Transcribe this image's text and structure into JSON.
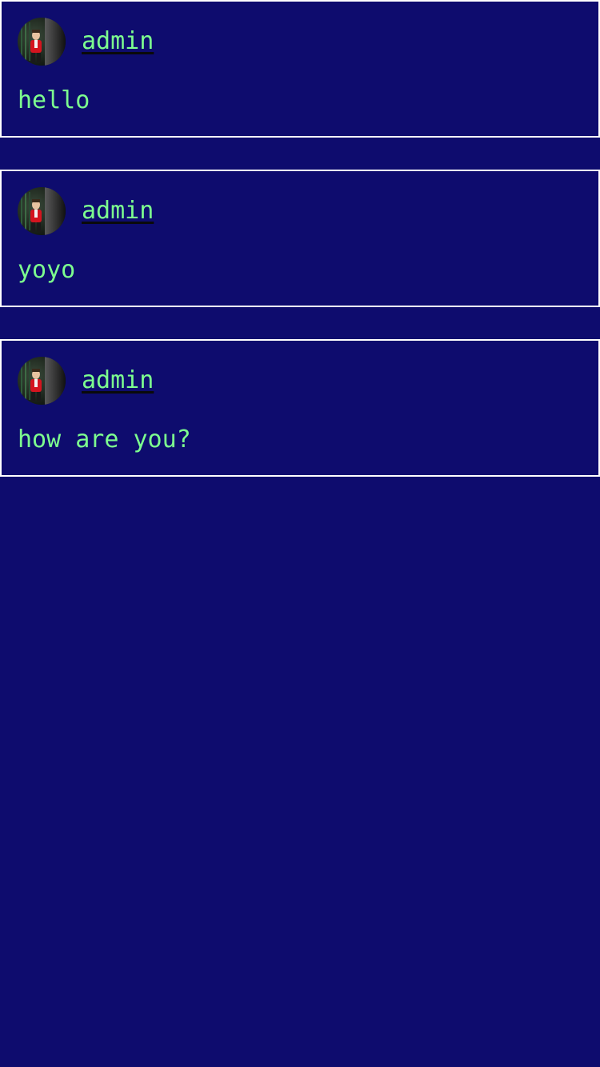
{
  "theme": {
    "background": "#0e0c6e",
    "text": "#7dff8f",
    "border": "#ffffff"
  },
  "posts": [
    {
      "author": "admin",
      "avatar_icon": "user-avatar-photo",
      "message": "hello"
    },
    {
      "author": "admin",
      "avatar_icon": "user-avatar-photo",
      "message": "yoyo"
    },
    {
      "author": "admin",
      "avatar_icon": "user-avatar-photo",
      "message": "how are you?"
    }
  ]
}
